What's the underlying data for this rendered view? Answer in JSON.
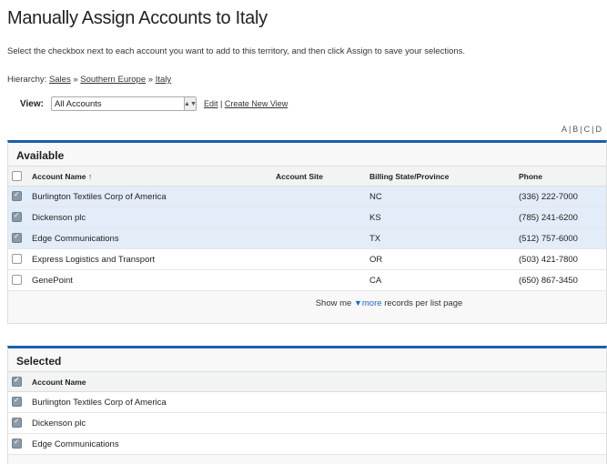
{
  "page": {
    "title": "Manually Assign Accounts to Italy",
    "instructions": "Select the checkbox next to each account you want to add to this territory, and then click Assign to save your selections."
  },
  "hierarchy": {
    "label": "Hierarchy:",
    "items": [
      "Sales",
      "Southern Europe",
      "Italy"
    ],
    "separator": "»"
  },
  "view": {
    "label": "View:",
    "selected": "All Accounts",
    "edit_link": "Edit",
    "create_link": "Create New View",
    "divider": "|"
  },
  "alpha_index": [
    "A",
    "B",
    "C",
    "D"
  ],
  "available": {
    "title": "Available",
    "columns": [
      "Account Name ↑",
      "Account Site",
      "Billing State/Province",
      "Phone"
    ],
    "rows": [
      {
        "name": "Burlington Textiles Corp of America",
        "site": "",
        "state": "NC",
        "phone": "(336) 222-7000",
        "checked": true
      },
      {
        "name": "Dickenson plc",
        "site": "",
        "state": "KS",
        "phone": "(785) 241-6200",
        "checked": true
      },
      {
        "name": "Edge Communications",
        "site": "",
        "state": "TX",
        "phone": "(512) 757-6000",
        "checked": true
      },
      {
        "name": "Express Logistics and Transport",
        "site": "",
        "state": "OR",
        "phone": "(503) 421-7800",
        "checked": false
      },
      {
        "name": "GenePoint",
        "site": "",
        "state": "CA",
        "phone": "(650) 867-3450",
        "checked": false
      }
    ],
    "show_me": {
      "prefix": "Show me",
      "link": "more",
      "suffix": "records per list page"
    }
  },
  "selected": {
    "title": "Selected",
    "columns": [
      "Account Name"
    ],
    "rows": [
      {
        "name": "Burlington Textiles Corp of America"
      },
      {
        "name": "Dickenson plc"
      },
      {
        "name": "Edge Communications"
      }
    ]
  },
  "colors": {
    "accent": "#1b5faa",
    "link": "#1b6ac9",
    "checked_row": "#e3edf9"
  }
}
